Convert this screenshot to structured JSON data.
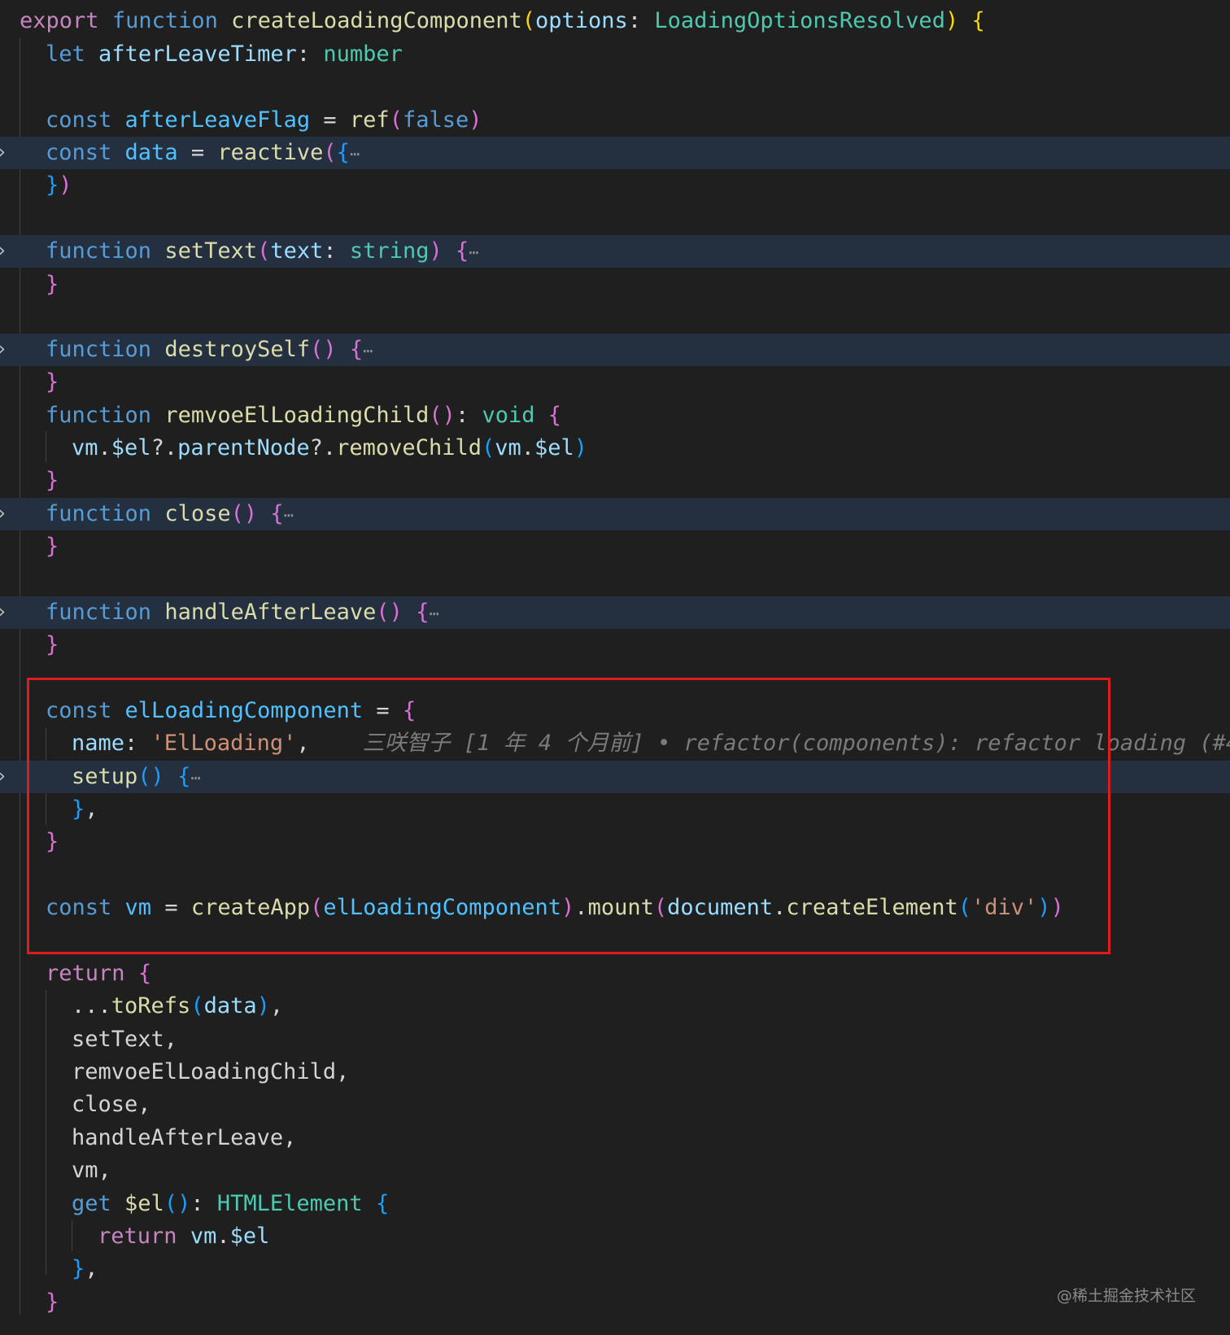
{
  "editor": {
    "theme_colors": {
      "background": "#1f1f1f",
      "folded_line": "#243040",
      "keyword": "#569cd6",
      "control": "#c586c0",
      "function": "#dcdcaa",
      "variable": "#9cdcfe",
      "type": "#4ec9b0",
      "string": "#ce9178",
      "highlight_box": "#e01b1b"
    },
    "code": {
      "l1": {
        "export": "export",
        "function": "function",
        "name": "createLoadingComponent",
        "param": "options",
        "type": "LoadingOptionsResolved"
      },
      "l2": {
        "let": "let",
        "name": "afterLeaveTimer",
        "type": "number"
      },
      "l3": {
        "const": "const",
        "name": "afterLeaveFlag",
        "call": "ref",
        "arg": "false"
      },
      "l4": {
        "const": "const",
        "name": "data",
        "call": "reactive",
        "ellipsis": "⋯"
      },
      "l6": {
        "function": "function",
        "name": "setText",
        "param": "text",
        "type": "string",
        "ellipsis": "⋯"
      },
      "l8": {
        "function": "function",
        "name": "destroySelf",
        "ellipsis": "⋯"
      },
      "l10": {
        "function": "function",
        "name": "remvoeElLoadingChild",
        "type": "void"
      },
      "l11": {
        "obj": "vm",
        "prop1": "$el",
        "prop2": "parentNode",
        "call": "removeChild",
        "argObj": "vm",
        "argProp": "$el"
      },
      "l13": {
        "function": "function",
        "name": "close",
        "ellipsis": "⋯"
      },
      "l15": {
        "function": "function",
        "name": "handleAfterLeave",
        "ellipsis": "⋯"
      },
      "l17": {
        "const": "const",
        "name": "elLoadingComponent"
      },
      "l18": {
        "key": "name",
        "value": "'ElLoading'",
        "blame": "三咲智子 [1 年 4 个月前] • refactor(components): refactor loading (#4"
      },
      "l19": {
        "name": "setup",
        "ellipsis": "⋯"
      },
      "l22": {
        "const": "const",
        "name": "vm",
        "call1": "createApp",
        "arg1": "elLoadingComponent",
        "call2": "mount",
        "obj": "document",
        "call3": "createElement",
        "arg3": "'div'"
      },
      "l23": {
        "return": "return"
      },
      "l24": {
        "spread": "...",
        "call": "toRefs",
        "arg": "data"
      },
      "l25": {
        "name": "setText"
      },
      "l26": {
        "name": "remvoeElLoadingChild"
      },
      "l27": {
        "name": "close"
      },
      "l28": {
        "name": "handleAfterLeave"
      },
      "l29": {
        "name": "vm"
      },
      "l30": {
        "get": "get",
        "name": "$el",
        "type": "HTMLElement"
      },
      "l31": {
        "return": "return",
        "obj": "vm",
        "prop": "$el"
      }
    },
    "watermark": "@稀土掘金技术社区"
  }
}
